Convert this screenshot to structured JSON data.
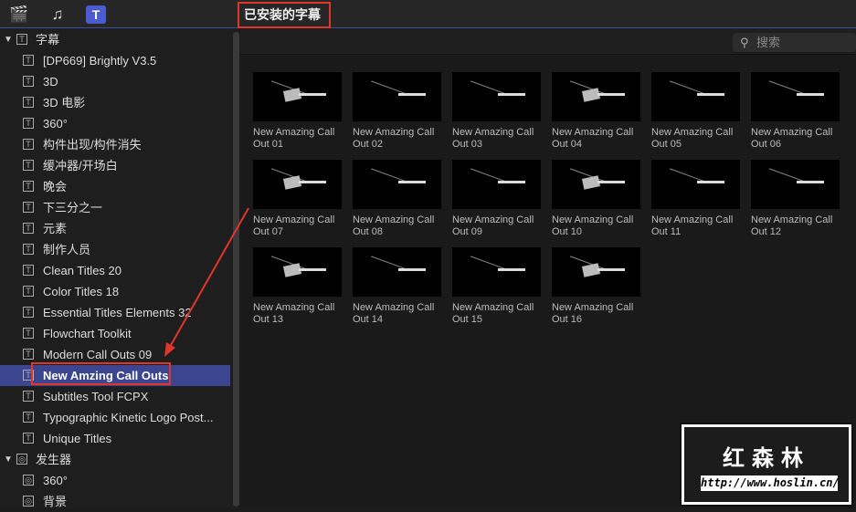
{
  "toolbar": {
    "icons": [
      "clapper-star-icon",
      "music-photo-icon",
      "titles-icon"
    ],
    "dropdown_label": "已安装的字幕",
    "dropdown_arrows": "⌃⌄"
  },
  "search": {
    "placeholder": "搜索",
    "icon": "magnifier-icon"
  },
  "sidebar": {
    "groups": [
      {
        "label": "字幕",
        "items": [
          "[DP669] Brightly V3.5",
          "3D",
          "3D 电影",
          "360°",
          "构件出现/构件消失",
          "缓冲器/开场白",
          "晚会",
          "下三分之一",
          "元素",
          "制作人员",
          "Clean Titles 20",
          "Color Titles 18",
          "Essential Titles Elements 32",
          "Flowchart Toolkit",
          "Modern Call Outs 09",
          "New Amzing Call Outs",
          "Subtitles Tool FCPX",
          "Typographic Kinetic Logo Post...",
          "Unique Titles"
        ],
        "selected": 15
      },
      {
        "label": "发生器",
        "items": [
          "360°",
          "背景"
        ]
      }
    ]
  },
  "tiles": [
    "New Amazing Call Out 01",
    "New Amazing Call Out 02",
    "New Amazing Call Out 03",
    "New Amazing Call Out 04",
    "New Amazing Call Out 05",
    "New Amazing Call Out 06",
    "New Amazing Call Out 07",
    "New Amazing Call Out 08",
    "New Amazing Call Out 09",
    "New Amazing Call Out 10",
    "New Amazing Call Out 11",
    "New Amazing Call Out 12",
    "New Amazing Call Out 13",
    "New Amazing Call Out 14",
    "New Amazing Call Out 15",
    "New Amazing Call Out 16"
  ],
  "watermark": {
    "title": "红森林",
    "url": "http://www.hoslin.cn/"
  },
  "colors": {
    "annotation": "#e0352b",
    "selection": "#3c4690",
    "accent": "#4a5cd0"
  }
}
